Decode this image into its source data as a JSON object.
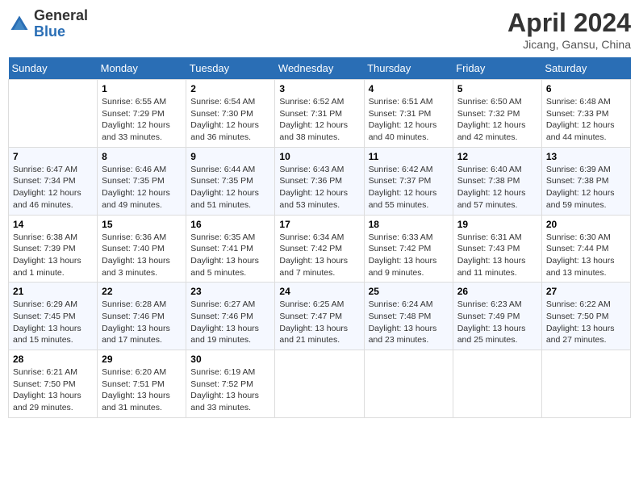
{
  "header": {
    "logo_general": "General",
    "logo_blue": "Blue",
    "title": "April 2024",
    "subtitle": "Jicang, Gansu, China"
  },
  "days_of_week": [
    "Sunday",
    "Monday",
    "Tuesday",
    "Wednesday",
    "Thursday",
    "Friday",
    "Saturday"
  ],
  "weeks": [
    [
      {
        "day": "",
        "sunrise": "",
        "sunset": "",
        "daylight": ""
      },
      {
        "day": "1",
        "sunrise": "Sunrise: 6:55 AM",
        "sunset": "Sunset: 7:29 PM",
        "daylight": "Daylight: 12 hours and 33 minutes."
      },
      {
        "day": "2",
        "sunrise": "Sunrise: 6:54 AM",
        "sunset": "Sunset: 7:30 PM",
        "daylight": "Daylight: 12 hours and 36 minutes."
      },
      {
        "day": "3",
        "sunrise": "Sunrise: 6:52 AM",
        "sunset": "Sunset: 7:31 PM",
        "daylight": "Daylight: 12 hours and 38 minutes."
      },
      {
        "day": "4",
        "sunrise": "Sunrise: 6:51 AM",
        "sunset": "Sunset: 7:31 PM",
        "daylight": "Daylight: 12 hours and 40 minutes."
      },
      {
        "day": "5",
        "sunrise": "Sunrise: 6:50 AM",
        "sunset": "Sunset: 7:32 PM",
        "daylight": "Daylight: 12 hours and 42 minutes."
      },
      {
        "day": "6",
        "sunrise": "Sunrise: 6:48 AM",
        "sunset": "Sunset: 7:33 PM",
        "daylight": "Daylight: 12 hours and 44 minutes."
      }
    ],
    [
      {
        "day": "7",
        "sunrise": "Sunrise: 6:47 AM",
        "sunset": "Sunset: 7:34 PM",
        "daylight": "Daylight: 12 hours and 46 minutes."
      },
      {
        "day": "8",
        "sunrise": "Sunrise: 6:46 AM",
        "sunset": "Sunset: 7:35 PM",
        "daylight": "Daylight: 12 hours and 49 minutes."
      },
      {
        "day": "9",
        "sunrise": "Sunrise: 6:44 AM",
        "sunset": "Sunset: 7:35 PM",
        "daylight": "Daylight: 12 hours and 51 minutes."
      },
      {
        "day": "10",
        "sunrise": "Sunrise: 6:43 AM",
        "sunset": "Sunset: 7:36 PM",
        "daylight": "Daylight: 12 hours and 53 minutes."
      },
      {
        "day": "11",
        "sunrise": "Sunrise: 6:42 AM",
        "sunset": "Sunset: 7:37 PM",
        "daylight": "Daylight: 12 hours and 55 minutes."
      },
      {
        "day": "12",
        "sunrise": "Sunrise: 6:40 AM",
        "sunset": "Sunset: 7:38 PM",
        "daylight": "Daylight: 12 hours and 57 minutes."
      },
      {
        "day": "13",
        "sunrise": "Sunrise: 6:39 AM",
        "sunset": "Sunset: 7:38 PM",
        "daylight": "Daylight: 12 hours and 59 minutes."
      }
    ],
    [
      {
        "day": "14",
        "sunrise": "Sunrise: 6:38 AM",
        "sunset": "Sunset: 7:39 PM",
        "daylight": "Daylight: 13 hours and 1 minute."
      },
      {
        "day": "15",
        "sunrise": "Sunrise: 6:36 AM",
        "sunset": "Sunset: 7:40 PM",
        "daylight": "Daylight: 13 hours and 3 minutes."
      },
      {
        "day": "16",
        "sunrise": "Sunrise: 6:35 AM",
        "sunset": "Sunset: 7:41 PM",
        "daylight": "Daylight: 13 hours and 5 minutes."
      },
      {
        "day": "17",
        "sunrise": "Sunrise: 6:34 AM",
        "sunset": "Sunset: 7:42 PM",
        "daylight": "Daylight: 13 hours and 7 minutes."
      },
      {
        "day": "18",
        "sunrise": "Sunrise: 6:33 AM",
        "sunset": "Sunset: 7:42 PM",
        "daylight": "Daylight: 13 hours and 9 minutes."
      },
      {
        "day": "19",
        "sunrise": "Sunrise: 6:31 AM",
        "sunset": "Sunset: 7:43 PM",
        "daylight": "Daylight: 13 hours and 11 minutes."
      },
      {
        "day": "20",
        "sunrise": "Sunrise: 6:30 AM",
        "sunset": "Sunset: 7:44 PM",
        "daylight": "Daylight: 13 hours and 13 minutes."
      }
    ],
    [
      {
        "day": "21",
        "sunrise": "Sunrise: 6:29 AM",
        "sunset": "Sunset: 7:45 PM",
        "daylight": "Daylight: 13 hours and 15 minutes."
      },
      {
        "day": "22",
        "sunrise": "Sunrise: 6:28 AM",
        "sunset": "Sunset: 7:46 PM",
        "daylight": "Daylight: 13 hours and 17 minutes."
      },
      {
        "day": "23",
        "sunrise": "Sunrise: 6:27 AM",
        "sunset": "Sunset: 7:46 PM",
        "daylight": "Daylight: 13 hours and 19 minutes."
      },
      {
        "day": "24",
        "sunrise": "Sunrise: 6:25 AM",
        "sunset": "Sunset: 7:47 PM",
        "daylight": "Daylight: 13 hours and 21 minutes."
      },
      {
        "day": "25",
        "sunrise": "Sunrise: 6:24 AM",
        "sunset": "Sunset: 7:48 PM",
        "daylight": "Daylight: 13 hours and 23 minutes."
      },
      {
        "day": "26",
        "sunrise": "Sunrise: 6:23 AM",
        "sunset": "Sunset: 7:49 PM",
        "daylight": "Daylight: 13 hours and 25 minutes."
      },
      {
        "day": "27",
        "sunrise": "Sunrise: 6:22 AM",
        "sunset": "Sunset: 7:50 PM",
        "daylight": "Daylight: 13 hours and 27 minutes."
      }
    ],
    [
      {
        "day": "28",
        "sunrise": "Sunrise: 6:21 AM",
        "sunset": "Sunset: 7:50 PM",
        "daylight": "Daylight: 13 hours and 29 minutes."
      },
      {
        "day": "29",
        "sunrise": "Sunrise: 6:20 AM",
        "sunset": "Sunset: 7:51 PM",
        "daylight": "Daylight: 13 hours and 31 minutes."
      },
      {
        "day": "30",
        "sunrise": "Sunrise: 6:19 AM",
        "sunset": "Sunset: 7:52 PM",
        "daylight": "Daylight: 13 hours and 33 minutes."
      },
      {
        "day": "",
        "sunrise": "",
        "sunset": "",
        "daylight": ""
      },
      {
        "day": "",
        "sunrise": "",
        "sunset": "",
        "daylight": ""
      },
      {
        "day": "",
        "sunrise": "",
        "sunset": "",
        "daylight": ""
      },
      {
        "day": "",
        "sunrise": "",
        "sunset": "",
        "daylight": ""
      }
    ]
  ]
}
